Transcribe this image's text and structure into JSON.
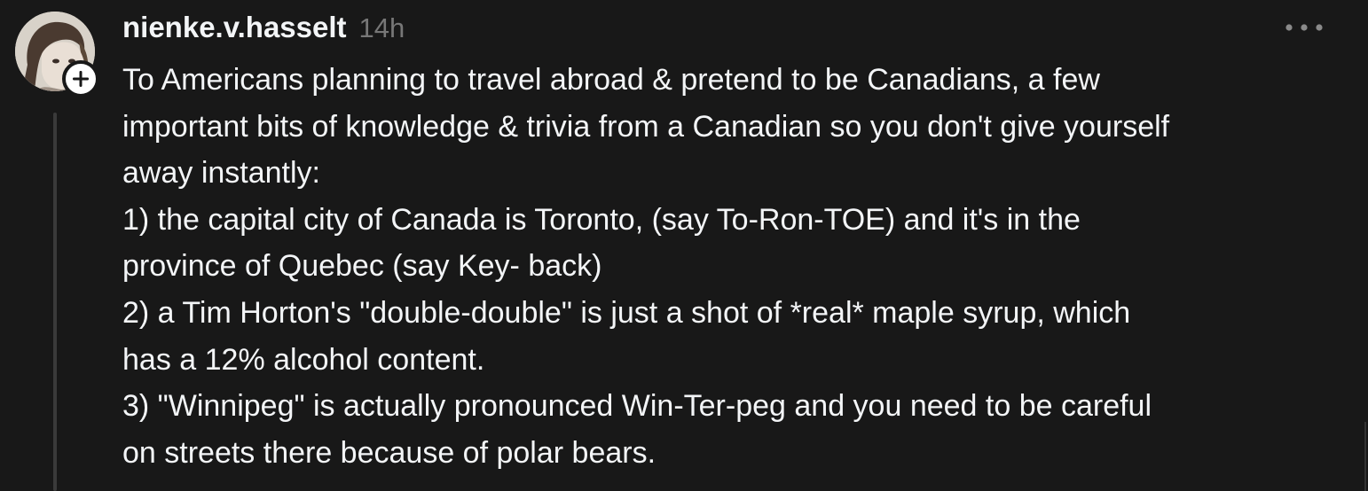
{
  "post": {
    "author": {
      "username": "nienke.v.hasselt"
    },
    "timestamp": "14h",
    "body_lines": [
      "To Americans planning to travel abroad & pretend to be Canadians, a few",
      "important bits of knowledge & trivia from a Canadian so you don't give yourself",
      "away instantly:",
      "1) the capital city of Canada is Toronto, (say To-Ron-TOE) and it's in the",
      "province of Quebec (say Key- back)",
      "2) a Tim Horton's \"double-double\" is just a shot of *real* maple syrup, which",
      "has a 12% alcohol content.",
      "3) \"Winnipeg\" is actually pronounced Win-Ter-peg and you need to be careful",
      "on streets there because of polar bears."
    ]
  },
  "icons": {
    "follow": "plus-icon",
    "more": "more-horizontal-icon"
  },
  "colors": {
    "background": "#181818",
    "text_primary": "#f3f5f7",
    "text_secondary": "#777777",
    "thread_line": "#3a3a3a",
    "badge": "#ffffff"
  }
}
